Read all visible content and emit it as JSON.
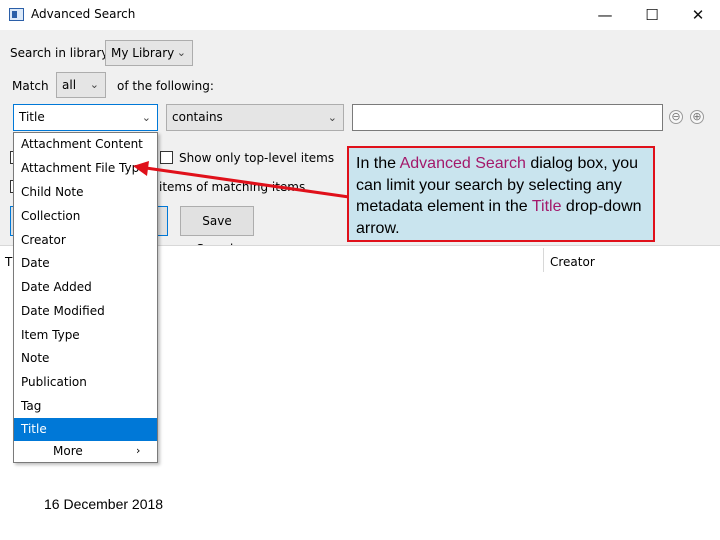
{
  "window": {
    "title": "Advanced Search",
    "controls": {
      "minimize": "—",
      "maximize": "☐",
      "close": "✕"
    }
  },
  "search": {
    "library_label": "Search in library:",
    "library_value": "My Library",
    "match_label": "Match",
    "match_value": "all",
    "following_label": "of the following:"
  },
  "condition": {
    "field_value": "Title",
    "operator_value": "contains",
    "text_value": "",
    "remove_symbol": "⊖",
    "add_symbol": "⊕"
  },
  "options": {
    "top_level_label": "Show only top-level items",
    "matching_label": "items of matching items"
  },
  "buttons": {
    "save_search": "Save Search"
  },
  "results": {
    "col_title_partial": "Ti",
    "col_creator": "Creator"
  },
  "dropdown": {
    "items": [
      "Attachment Content",
      "Attachment File Type",
      "Child Note",
      "Collection",
      "Creator",
      "Date",
      "Date Added",
      "Date Modified",
      "Item Type",
      "Note",
      "Publication",
      "Tag",
      "Title"
    ],
    "selected": "Title",
    "more_label": "More",
    "more_chevron": "›"
  },
  "callout": {
    "part1": "In the ",
    "hl1": "Advanced Search",
    "part2": " dialog box, you can limit your search by selecting any metadata element in the ",
    "hl2": "Title",
    "part3": " drop-down arrow."
  },
  "colors": {
    "selection": "#0078d7",
    "callout_bg": "#c9e4ee",
    "callout_border": "#e0101a",
    "highlight_text": "#a3186b",
    "arrow": "#e0101a"
  },
  "footer": {
    "date": "16 December 2018"
  }
}
